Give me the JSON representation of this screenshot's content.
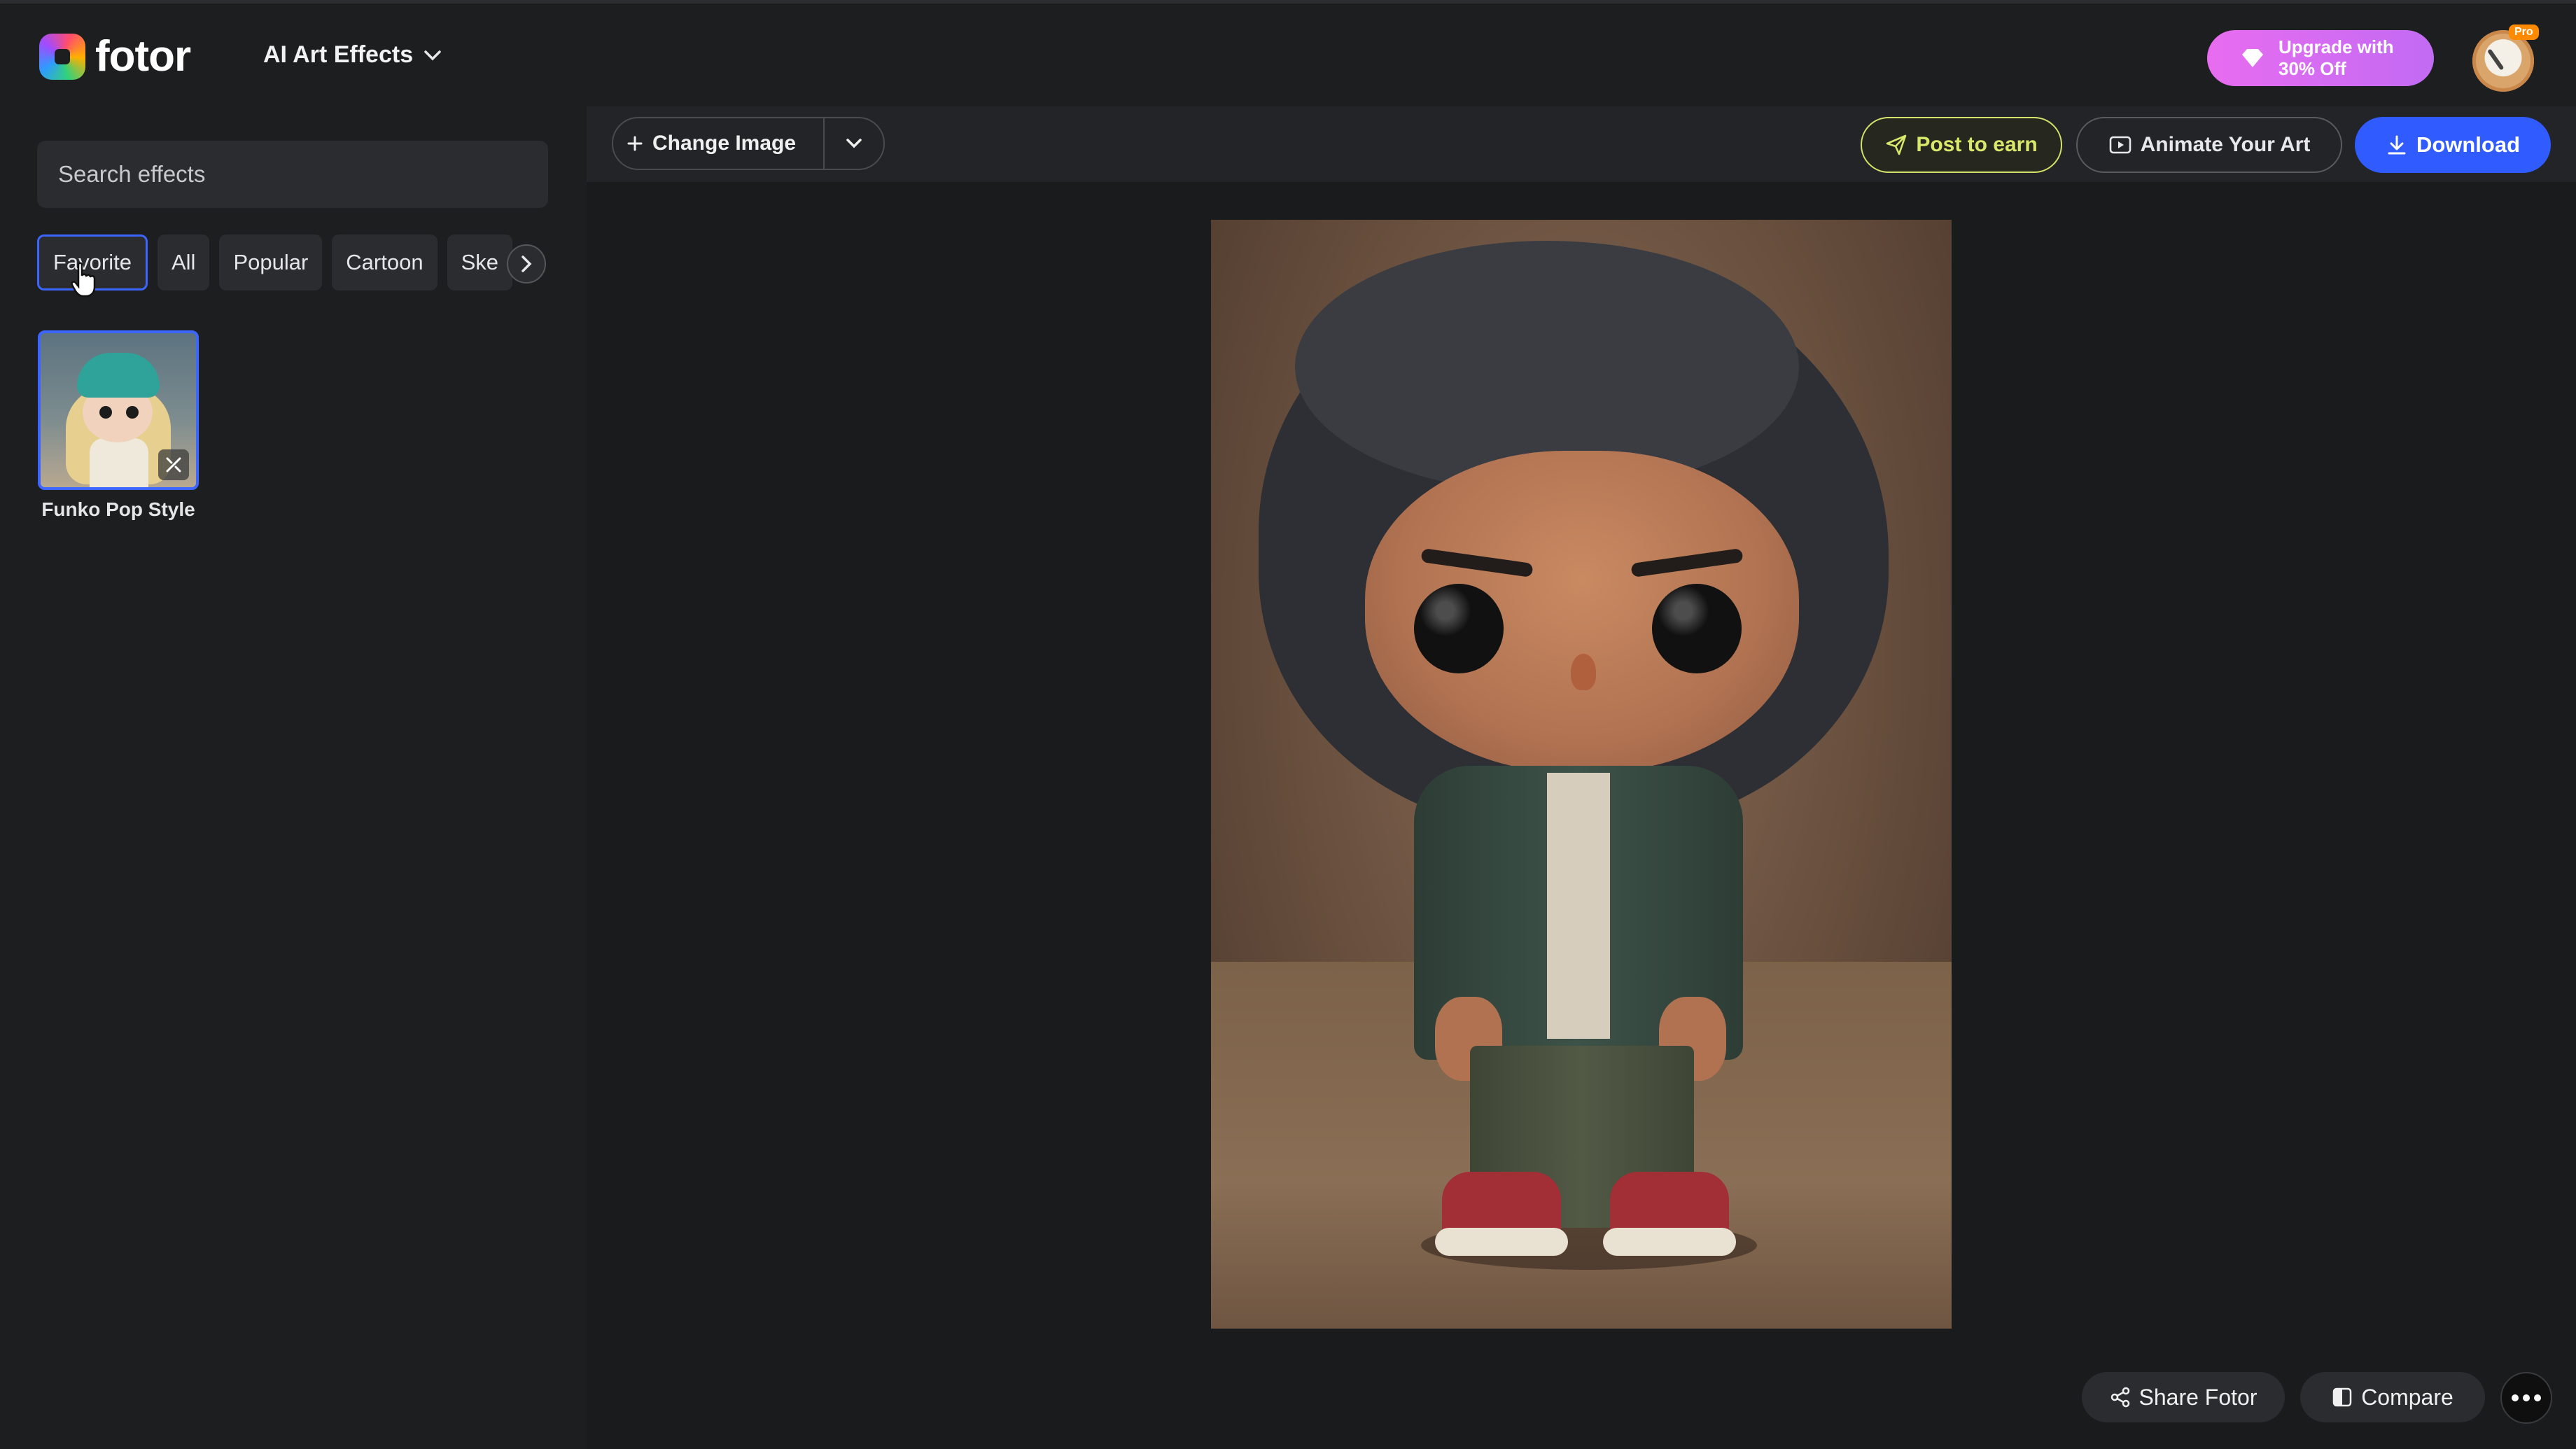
{
  "header": {
    "logo_text": "fotor",
    "menu_label": "AI Art Effects",
    "upgrade_line1": "Upgrade with",
    "upgrade_line2": "30% Off",
    "pro_badge": "Pro"
  },
  "sidebar": {
    "search_placeholder": "Search effects",
    "tabs": [
      "Favorite",
      "All",
      "Popular",
      "Cartoon",
      "Ske"
    ],
    "active_tab": "Favorite",
    "effects": [
      {
        "name": "Funko Pop Style"
      }
    ]
  },
  "toolbar": {
    "change_image": "Change Image",
    "post_to_earn": "Post to earn",
    "animate": "Animate Your Art",
    "download": "Download"
  },
  "bottom": {
    "share": "Share Fotor",
    "compare": "Compare"
  },
  "colors": {
    "accent": "#2f5bff",
    "post_accent": "#d9e86b",
    "upgrade_gradient_start": "#e86cf0",
    "upgrade_gradient_end": "#c26bf3",
    "background": "#1a1b1d"
  },
  "icons": [
    "chevron-down-icon",
    "gem-icon",
    "chevron-right-icon",
    "cursor-pointer-icon",
    "magic-wand-icon",
    "plus-icon",
    "paper-plane-icon",
    "animate-icon",
    "download-icon",
    "share-icon",
    "compare-icon",
    "more-icon"
  ]
}
